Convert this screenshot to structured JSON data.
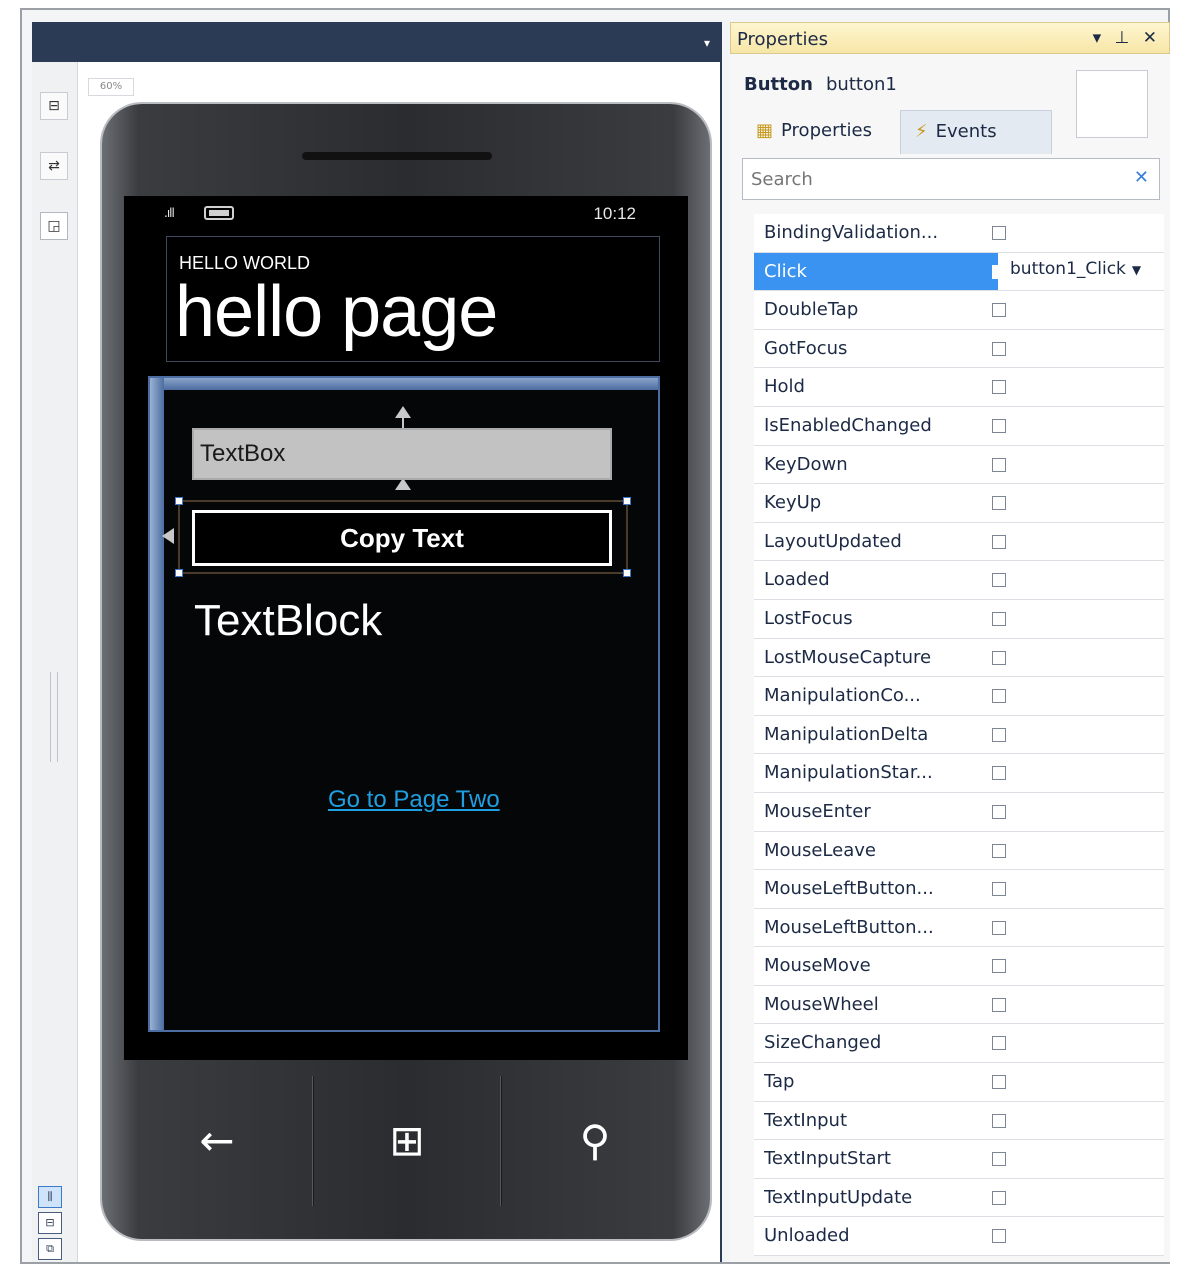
{
  "designer": {
    "zoom": "60%",
    "dropdown_glyph": "▾",
    "left_strip": [
      "⊟",
      "⇄",
      "◲"
    ],
    "bottom_strip": [
      "⫼",
      "⊟",
      "⧉"
    ]
  },
  "phone": {
    "status_time": "10:12",
    "signal": ".ıll",
    "app_title": "HELLO WORLD",
    "page_title": "hello page",
    "textbox_text": "TextBox",
    "button_label": "Copy Text",
    "textblock_text": "TextBlock",
    "link_text": "Go to Page Two",
    "nav": {
      "back": "←",
      "start": "⊞",
      "search": "⚲"
    }
  },
  "properties": {
    "title": "Properties",
    "controls": "▾ ⊥ ✕",
    "object_type": "Button",
    "object_name": "button1",
    "tab_properties": "Properties",
    "tab_events": "Events",
    "search_placeholder": "Search",
    "search_clear": "✕",
    "events": [
      {
        "name": "BindingValidation...",
        "value": ""
      },
      {
        "name": "Click",
        "value": "button1_Click",
        "selected": true
      },
      {
        "name": "DoubleTap",
        "value": ""
      },
      {
        "name": "GotFocus",
        "value": ""
      },
      {
        "name": "Hold",
        "value": ""
      },
      {
        "name": "IsEnabledChanged",
        "value": ""
      },
      {
        "name": "KeyDown",
        "value": ""
      },
      {
        "name": "KeyUp",
        "value": ""
      },
      {
        "name": "LayoutUpdated",
        "value": ""
      },
      {
        "name": "Loaded",
        "value": ""
      },
      {
        "name": "LostFocus",
        "value": ""
      },
      {
        "name": "LostMouseCapture",
        "value": ""
      },
      {
        "name": "ManipulationCo...",
        "value": ""
      },
      {
        "name": "ManipulationDelta",
        "value": ""
      },
      {
        "name": "ManipulationStar...",
        "value": ""
      },
      {
        "name": "MouseEnter",
        "value": ""
      },
      {
        "name": "MouseLeave",
        "value": ""
      },
      {
        "name": "MouseLeftButton...",
        "value": ""
      },
      {
        "name": "MouseLeftButton...",
        "value": ""
      },
      {
        "name": "MouseMove",
        "value": ""
      },
      {
        "name": "MouseWheel",
        "value": ""
      },
      {
        "name": "SizeChanged",
        "value": ""
      },
      {
        "name": "Tap",
        "value": ""
      },
      {
        "name": "TextInput",
        "value": ""
      },
      {
        "name": "TextInputStart",
        "value": ""
      },
      {
        "name": "TextInputUpdate",
        "value": ""
      },
      {
        "name": "Unloaded",
        "value": ""
      }
    ]
  }
}
